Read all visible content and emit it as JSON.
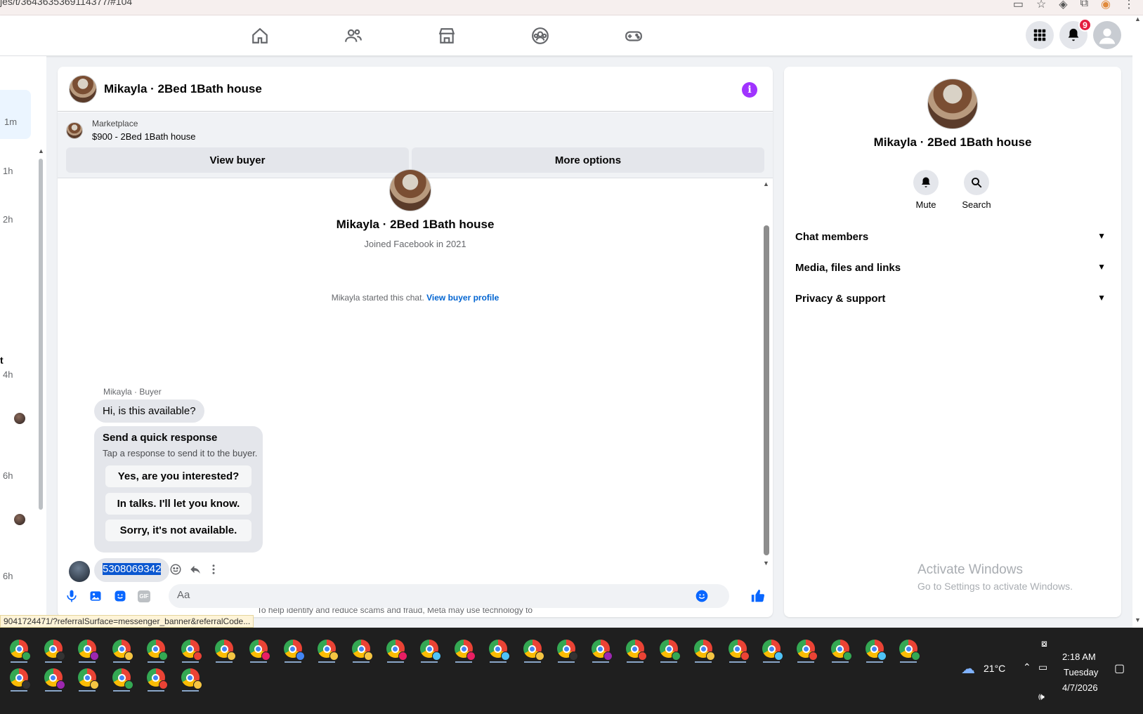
{
  "browser": {
    "url": "jes/t/3643635369114377/#104"
  },
  "topnav": {
    "nav_icons": [
      "home-icon",
      "friends-icon",
      "marketplace-icon",
      "groups-icon",
      "gaming-icon"
    ],
    "notifications_badge": "9"
  },
  "left_list": {
    "times": [
      "1m",
      "1h",
      "2h",
      "4h",
      "6h",
      "6h"
    ],
    "partial_text": "t"
  },
  "chat": {
    "title": "Mikayla · 2Bed 1Bath house",
    "info_icon": "i",
    "marketplace_label": "Marketplace",
    "listing": "$900 - 2Bed 1Bath house",
    "view_buyer": "View buyer",
    "more_options": "More options",
    "profile_name": "Mikayla · 2Bed 1Bath house",
    "joined": "Joined Facebook in 2021",
    "started_text": "Mikayla started this chat.",
    "view_buyer_profile": "View buyer profile",
    "sender_label": "Mikayla · Buyer",
    "first_message": "Hi, is this available?",
    "quick_title": "Send a quick response",
    "quick_subtitle": "Tap a response to send it to the buyer.",
    "quick_options": [
      "Yes, are you interested?",
      "In talks. I'll let you know.",
      "Sorry, it's not available."
    ],
    "my_message": "5308069342",
    "disclaimer": "To help identify and reduce scams and fraud, Meta may use technology to review Marketplace messages.",
    "input_placeholder": "Aa",
    "gif_label": "GIF"
  },
  "right_panel": {
    "name": "Mikayla · 2Bed 1Bath house",
    "mute": "Mute",
    "search": "Search",
    "sections": [
      "Chat members",
      "Media, files and links",
      "Privacy & support"
    ],
    "activate_title": "Activate Windows",
    "activate_sub": "Go to Settings to activate Windows."
  },
  "status_link": "9041724471/?referralSurface=messenger_banner&referralCode...",
  "taskbar": {
    "weather": "21°C",
    "time": "2:18 AM",
    "day": "Tuesday",
    "date": "4/7/2026"
  },
  "colors": {
    "accent_blue": "#0064d1",
    "info_purple": "#a033ff",
    "badge_red": "#e41e3f",
    "taskbar": "#1f1f1f"
  }
}
